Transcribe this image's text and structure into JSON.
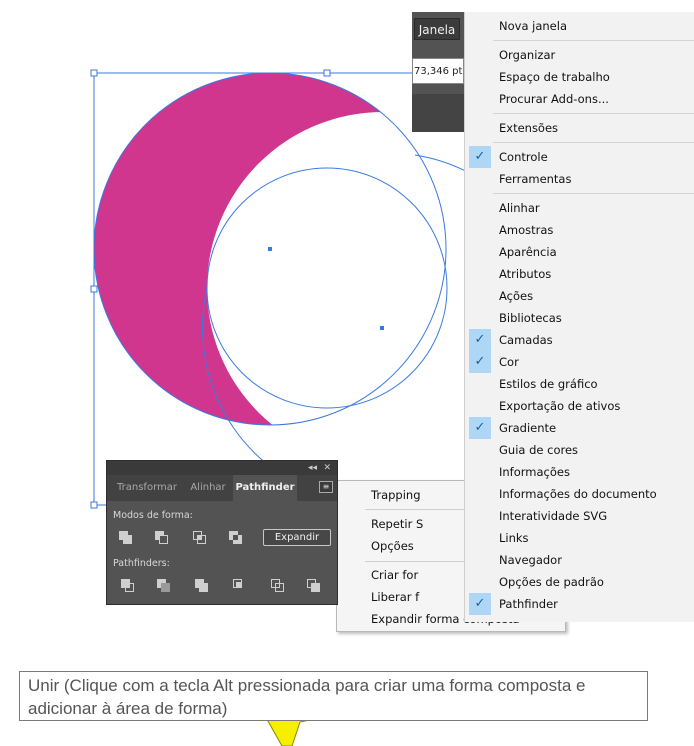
{
  "control_bar": {
    "window_tab": "Janela",
    "value_field": "73,346 pt"
  },
  "window_menu": {
    "items": [
      {
        "label": "Nova janela",
        "checked": false
      },
      {
        "label": "Organizar",
        "checked": false
      },
      {
        "label": "Espaço de trabalho",
        "checked": false
      },
      {
        "label": "Procurar Add-ons...",
        "checked": false
      },
      {
        "label": "Extensões",
        "checked": false
      },
      {
        "label": "Controle",
        "checked": true
      },
      {
        "label": "Ferramentas",
        "checked": false
      },
      {
        "label": "Alinhar",
        "checked": false
      },
      {
        "label": "Amostras",
        "checked": false
      },
      {
        "label": "Aparência",
        "checked": false
      },
      {
        "label": "Atributos",
        "checked": false
      },
      {
        "label": "Ações",
        "checked": false
      },
      {
        "label": "Bibliotecas",
        "checked": false
      },
      {
        "label": "Camadas",
        "checked": true
      },
      {
        "label": "Cor",
        "checked": true
      },
      {
        "label": "Estilos de gráfico",
        "checked": false
      },
      {
        "label": "Exportação de ativos",
        "checked": false
      },
      {
        "label": "Gradiente",
        "checked": true
      },
      {
        "label": "Guia de cores",
        "checked": false
      },
      {
        "label": "Informações",
        "checked": false
      },
      {
        "label": "Informações do documento",
        "checked": false
      },
      {
        "label": "Interatividade SVG",
        "checked": false
      },
      {
        "label": "Links",
        "checked": false
      },
      {
        "label": "Navegador",
        "checked": false
      },
      {
        "label": "Opções de padrão",
        "checked": false
      },
      {
        "label": "Pathfinder",
        "checked": true
      }
    ],
    "check_glyph": "✓"
  },
  "panel_flyout": {
    "items": [
      "Trapping",
      "Repetir S",
      "Opções",
      "Criar for",
      "Liberar f",
      "Expandir forma composta"
    ]
  },
  "pathfinder_panel": {
    "collapse_glyph": "◂◂",
    "close_glyph": "✕",
    "tabs": [
      {
        "label": "Transformar",
        "active": false
      },
      {
        "label": "Alinhar",
        "active": false
      },
      {
        "label": "Pathfinder",
        "active": true
      }
    ],
    "menu_glyph": "≡",
    "shape_modes_label": "Modos de forma:",
    "pathfinders_label": "Pathfinders:",
    "expand_label": "Expandir"
  },
  "tooltip": {
    "line1": "Unir (Clique com a tecla Alt pressionada para criar uma forma composta e",
    "line2": "adicionar à área de forma)"
  },
  "colors": {
    "shape_fill": "#d0368e",
    "selection": "#3a7ae0",
    "arrow": "#f7ef00"
  }
}
